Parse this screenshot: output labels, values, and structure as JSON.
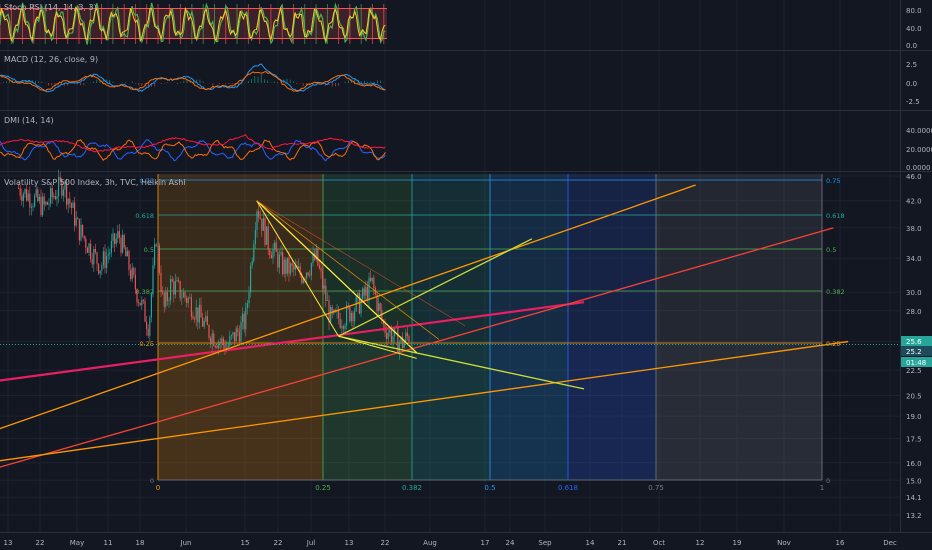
{
  "colors": {
    "background": "#131722",
    "grid": "#1e2230",
    "axis_text": "#b2b5be",
    "candle_up": "#26a69a",
    "candle_down": "#ef5350",
    "price_tag": "#26a69a",
    "stoch_k": "#4caf50",
    "stoch_d": "#ff5252",
    "macd_line": "#2196f3",
    "signal_line": "#ff6d00",
    "dmi_plus": "#2962ff",
    "dmi_minus": "#ff6d00",
    "adx": "#ff1744",
    "fib_zone_colors": [
      "#ff9800",
      "#4caf50",
      "#26a69a",
      "#2196f3",
      "#2962ff",
      "#787b86"
    ]
  },
  "x_axis": {
    "ticks": [
      "13",
      "22",
      "May",
      "11",
      "18",
      "Jun",
      "15",
      "22",
      "Jul",
      "13",
      "22",
      "Aug",
      "17",
      "24",
      "Sep",
      "14",
      "21",
      "Oct",
      "12",
      "19",
      "Nov",
      "16",
      "Dec"
    ]
  },
  "panes": {
    "stoch": {
      "legend": "Stoch RSI (14, 14, 3, 3)",
      "ticks": [
        "80.0",
        "40.0",
        "0.0"
      ]
    },
    "macd": {
      "legend": "MACD (12, 26, close, 9)",
      "ticks": [
        "2.5",
        "0.0",
        "-2.5"
      ]
    },
    "dmi": {
      "legend": "DMI (14, 14)",
      "ticks": [
        "40.0000",
        "20.0000",
        "0.0000"
      ]
    },
    "main": {
      "legend": "Volatility S&P 500 Index, 3h, TVC, Heikin Ashi",
      "ticks": [
        "46.0",
        "42.0",
        "38.0",
        "34.0",
        "30.0",
        "28.0",
        "25.0",
        "22.5",
        "20.5",
        "19.0",
        "17.5",
        "16.0",
        "15.0",
        "14.1",
        "13.2"
      ],
      "price_tags": [
        "25.6",
        "25.2",
        "01:48"
      ]
    }
  },
  "fib_time_zones": {
    "labels": [
      "0",
      "0.25",
      "0.382",
      "0.5",
      "0.618",
      "0.75",
      "1"
    ]
  },
  "fib_price_levels": {
    "left_labels": [
      "0.75",
      "0.618",
      "0.5",
      "0.382",
      "0.25",
      "0"
    ],
    "right_labels": [
      "0.75",
      "0.618",
      "0.5",
      "0.382",
      "0.25",
      "0"
    ]
  },
  "chart_data": {
    "type": "candlestick",
    "title": "Volatility S&P 500 Index, 3h, TVC, Heikin Ashi",
    "yscale": "log",
    "ylim": [
      13.2,
      46.0
    ],
    "grid": true,
    "ohlc_trend_points": [
      {
        "x": "Apr 8",
        "y": 44
      },
      {
        "x": "Apr 15",
        "y": 41
      },
      {
        "x": "Apr 20",
        "y": 45
      },
      {
        "x": "Apr 24",
        "y": 38
      },
      {
        "x": "Apr 30",
        "y": 33
      },
      {
        "x": "May 5",
        "y": 37
      },
      {
        "x": "May 9",
        "y": 31
      },
      {
        "x": "May 13",
        "y": 26.5
      },
      {
        "x": "May 15",
        "y": 37
      },
      {
        "x": "May 17",
        "y": 28
      },
      {
        "x": "May 19",
        "y": 31
      },
      {
        "x": "May 24",
        "y": 29
      },
      {
        "x": "May 29",
        "y": 26
      },
      {
        "x": "Jun 3",
        "y": 24.5
      },
      {
        "x": "Jun 8",
        "y": 27
      },
      {
        "x": "Jun 11",
        "y": 41.5
      },
      {
        "x": "Jun 14",
        "y": 36
      },
      {
        "x": "Jun 18",
        "y": 33
      },
      {
        "x": "Jun 23",
        "y": 32
      },
      {
        "x": "Jun 27",
        "y": 34
      },
      {
        "x": "Jul 1",
        "y": 27
      },
      {
        "x": "Jul 5",
        "y": 27.5
      },
      {
        "x": "Jul 9",
        "y": 29
      },
      {
        "x": "Jul 12",
        "y": 31
      },
      {
        "x": "Jul 15",
        "y": 26.5
      },
      {
        "x": "Jul 20",
        "y": 24.8
      },
      {
        "x": "Jul 22",
        "y": 25.6
      }
    ],
    "drawings": [
      {
        "name": "pink-trendline",
        "color": "#e91e63",
        "from": {
          "x": "Mar 30",
          "y": 21.5
        },
        "to": {
          "x": "Sep 7",
          "y": 28.9
        }
      },
      {
        "name": "red-trendline",
        "color": "#f44336",
        "from": {
          "x": "Mar 30",
          "y": 15.5
        },
        "to": {
          "x": "Nov 13",
          "y": 38
        }
      },
      {
        "name": "orange-trendline-upper",
        "color": "#ff9800",
        "from": {
          "x": "Mar 30",
          "y": 17.8
        },
        "to": {
          "x": "Oct 7",
          "y": 44.5
        }
      },
      {
        "name": "orange-trendline-lower",
        "color": "#ff9800",
        "from": {
          "x": "Mar 30",
          "y": 16
        },
        "to": {
          "x": "Nov 17",
          "y": 25
        }
      },
      {
        "name": "yellow-fan-upper",
        "color": "#cddc39",
        "from": {
          "x": "Jul 3",
          "y": 25.5
        },
        "to": {
          "x": "Aug 24",
          "y": 36.5
        }
      },
      {
        "name": "yellow-fan-lower",
        "color": "#cddc39",
        "from": {
          "x": "Jul 3",
          "y": 25.5
        },
        "to": {
          "x": "Sep 7",
          "y": 21
        }
      },
      {
        "name": "triangle-top",
        "color": "#ffeb3b",
        "from": {
          "x": "Jun 11",
          "y": 42
        },
        "to": {
          "x": "Jul 24",
          "y": 24
        }
      }
    ]
  }
}
